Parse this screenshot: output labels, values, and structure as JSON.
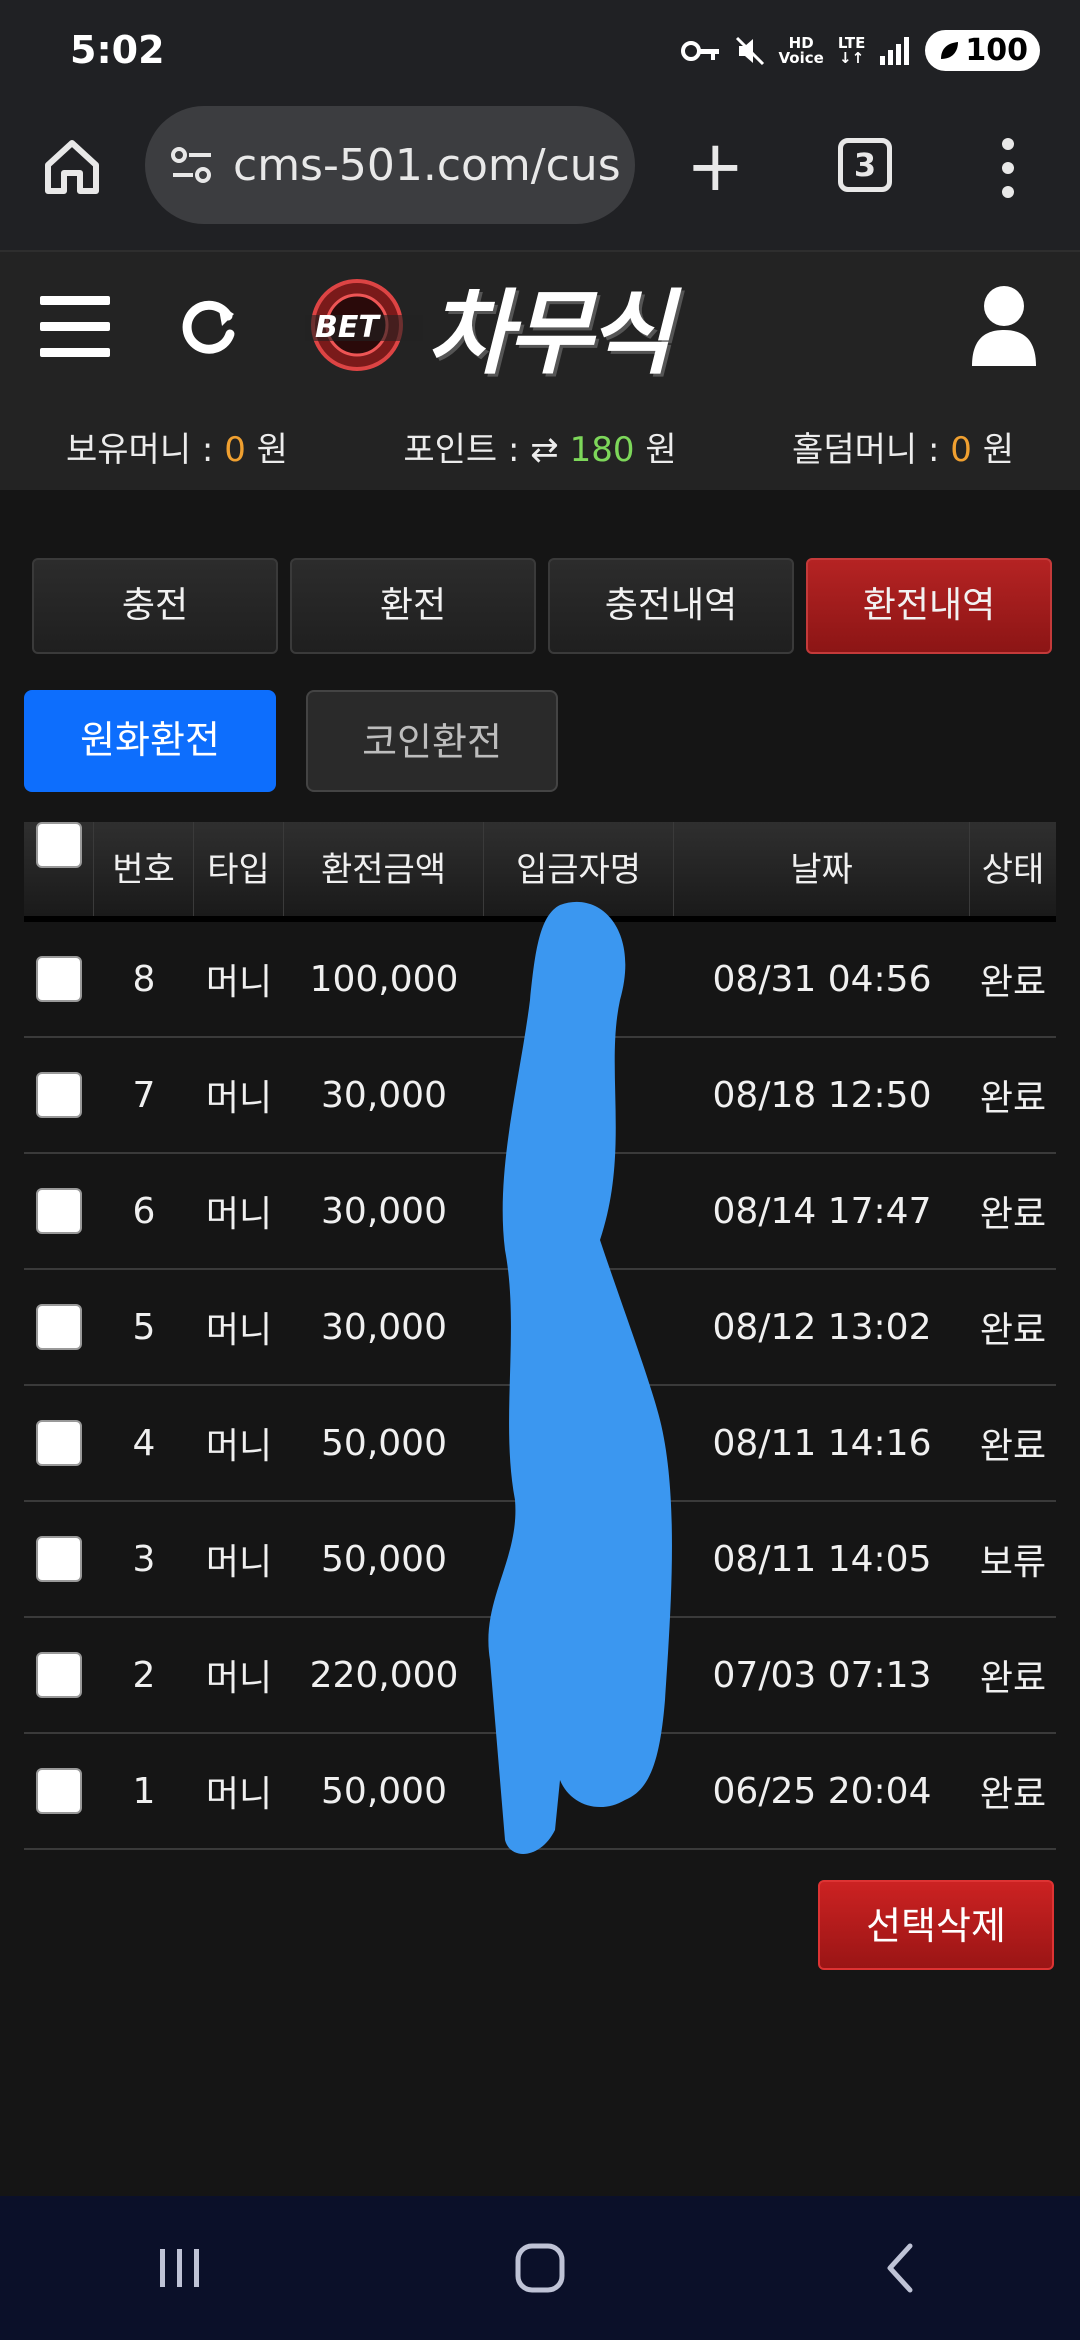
{
  "status_bar": {
    "time": "5:02",
    "hd_label": "HD",
    "voice_label": "Voice",
    "lte_label": "LTE",
    "battery": "100"
  },
  "browser": {
    "url": "cms-501.com/cus",
    "tab_count": "3"
  },
  "site": {
    "logo_badge": "BET",
    "logo_text": "차무식",
    "balances": {
      "money_label": "보유머니 :",
      "money_value": "0",
      "money_unit": "원",
      "point_label": "포인트 :",
      "point_value": "180",
      "point_unit": "원",
      "holdem_label": "홀덤머니 :",
      "holdem_value": "0",
      "holdem_unit": "원"
    }
  },
  "tabs": [
    {
      "label": "충전"
    },
    {
      "label": "환전"
    },
    {
      "label": "충전내역"
    },
    {
      "label": "환전내역",
      "active": true
    }
  ],
  "sub_tabs": [
    {
      "label": "원화환전",
      "active": true
    },
    {
      "label": "코인환전"
    }
  ],
  "table": {
    "headers": {
      "no": "번호",
      "type": "타입",
      "amount": "환전금액",
      "depositor": "입금자명",
      "date": "날짜",
      "status": "상태"
    },
    "rows": [
      {
        "no": "8",
        "type": "머니",
        "amount": "100,000",
        "date": "08/31 04:56",
        "status": "완료"
      },
      {
        "no": "7",
        "type": "머니",
        "amount": "30,000",
        "date": "08/18 12:50",
        "status": "완료"
      },
      {
        "no": "6",
        "type": "머니",
        "amount": "30,000",
        "date": "08/14 17:47",
        "status": "완료"
      },
      {
        "no": "5",
        "type": "머니",
        "amount": "30,000",
        "date": "08/12 13:02",
        "status": "완료"
      },
      {
        "no": "4",
        "type": "머니",
        "amount": "50,000",
        "date": "08/11 14:16",
        "status": "완료"
      },
      {
        "no": "3",
        "type": "머니",
        "amount": "50,000",
        "date": "08/11 14:05",
        "status": "보류"
      },
      {
        "no": "2",
        "type": "머니",
        "amount": "220,000",
        "date": "07/03 07:13",
        "status": "완료"
      },
      {
        "no": "1",
        "type": "머니",
        "amount": "50,000",
        "date": "06/25 20:04",
        "status": "완료"
      }
    ]
  },
  "delete_button": "선택삭제",
  "colors": {
    "accent_red": "#b52323",
    "accent_blue": "#0d6efd",
    "orange": "#f0a030",
    "green": "#7dd75a",
    "scribble": "#3b97f0"
  }
}
